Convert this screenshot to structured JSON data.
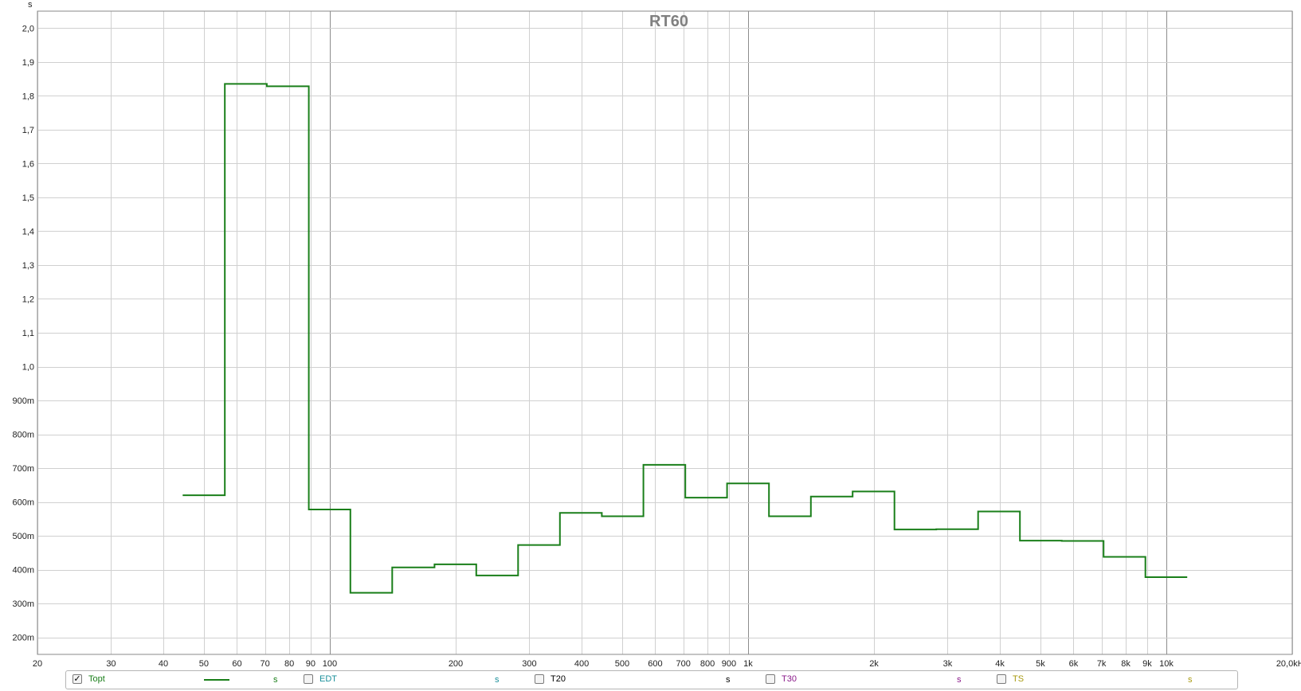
{
  "chart_data": {
    "type": "line",
    "title": "RT60",
    "ylabel": "s",
    "xlim": [
      20,
      20000
    ],
    "ylim": [
      0.15,
      2.05
    ],
    "x_scale": "log",
    "grid": true,
    "x_ticks": [
      {
        "v": 20,
        "label": "20"
      },
      {
        "v": 30,
        "label": "30"
      },
      {
        "v": 40,
        "label": "40"
      },
      {
        "v": 50,
        "label": "50"
      },
      {
        "v": 60,
        "label": "60"
      },
      {
        "v": 70,
        "label": "70"
      },
      {
        "v": 80,
        "label": "80"
      },
      {
        "v": 90,
        "label": "90"
      },
      {
        "v": 100,
        "label": "100"
      },
      {
        "v": 200,
        "label": "200"
      },
      {
        "v": 300,
        "label": "300"
      },
      {
        "v": 400,
        "label": "400"
      },
      {
        "v": 500,
        "label": "500"
      },
      {
        "v": 600,
        "label": "600"
      },
      {
        "v": 700,
        "label": "700"
      },
      {
        "v": 800,
        "label": "800"
      },
      {
        "v": 900,
        "label": "900"
      },
      {
        "v": 1000,
        "label": "1k"
      },
      {
        "v": 2000,
        "label": "2k"
      },
      {
        "v": 3000,
        "label": "3k"
      },
      {
        "v": 4000,
        "label": "4k"
      },
      {
        "v": 5000,
        "label": "5k"
      },
      {
        "v": 6000,
        "label": "6k"
      },
      {
        "v": 7000,
        "label": "7k"
      },
      {
        "v": 8000,
        "label": "8k"
      },
      {
        "v": 9000,
        "label": "9k"
      },
      {
        "v": 10000,
        "label": "10k"
      },
      {
        "v": 20000,
        "label": "20,0kHz"
      }
    ],
    "y_ticks": [
      {
        "v": 2.0,
        "label": "2,0"
      },
      {
        "v": 1.9,
        "label": "1,9"
      },
      {
        "v": 1.8,
        "label": "1,8"
      },
      {
        "v": 1.7,
        "label": "1,7"
      },
      {
        "v": 1.6,
        "label": "1,6"
      },
      {
        "v": 1.5,
        "label": "1,5"
      },
      {
        "v": 1.4,
        "label": "1,4"
      },
      {
        "v": 1.3,
        "label": "1,3"
      },
      {
        "v": 1.2,
        "label": "1,2"
      },
      {
        "v": 1.1,
        "label": "1,1"
      },
      {
        "v": 1.0,
        "label": "1,0"
      },
      {
        "v": 0.9,
        "label": "900m"
      },
      {
        "v": 0.8,
        "label": "800m"
      },
      {
        "v": 0.7,
        "label": "700m"
      },
      {
        "v": 0.6,
        "label": "600m"
      },
      {
        "v": 0.5,
        "label": "500m"
      },
      {
        "v": 0.4,
        "label": "400m"
      },
      {
        "v": 0.3,
        "label": "300m"
      },
      {
        "v": 0.2,
        "label": "200m"
      }
    ],
    "series": [
      {
        "name": "Topt",
        "color": "#1a7f1a",
        "step": true,
        "bands": [
          {
            "f_lo": 44.5,
            "f_hi": 56.1,
            "value": 0.62
          },
          {
            "f_lo": 56.1,
            "f_hi": 70.7,
            "value": 1.835
          },
          {
            "f_lo": 70.7,
            "f_hi": 89.1,
            "value": 1.828
          },
          {
            "f_lo": 89.1,
            "f_hi": 112,
            "value": 0.578
          },
          {
            "f_lo": 112,
            "f_hi": 141,
            "value": 0.332
          },
          {
            "f_lo": 141,
            "f_hi": 178,
            "value": 0.407
          },
          {
            "f_lo": 178,
            "f_hi": 224,
            "value": 0.416
          },
          {
            "f_lo": 224,
            "f_hi": 282,
            "value": 0.383
          },
          {
            "f_lo": 282,
            "f_hi": 355,
            "value": 0.473
          },
          {
            "f_lo": 355,
            "f_hi": 447,
            "value": 0.568
          },
          {
            "f_lo": 447,
            "f_hi": 562,
            "value": 0.558
          },
          {
            "f_lo": 562,
            "f_hi": 708,
            "value": 0.71
          },
          {
            "f_lo": 708,
            "f_hi": 891,
            "value": 0.613
          },
          {
            "f_lo": 891,
            "f_hi": 1122,
            "value": 0.655
          },
          {
            "f_lo": 1122,
            "f_hi": 1413,
            "value": 0.558
          },
          {
            "f_lo": 1413,
            "f_hi": 1778,
            "value": 0.616
          },
          {
            "f_lo": 1778,
            "f_hi": 2239,
            "value": 0.631
          },
          {
            "f_lo": 2239,
            "f_hi": 2818,
            "value": 0.519
          },
          {
            "f_lo": 2818,
            "f_hi": 3548,
            "value": 0.52
          },
          {
            "f_lo": 3548,
            "f_hi": 4467,
            "value": 0.572
          },
          {
            "f_lo": 4467,
            "f_hi": 5623,
            "value": 0.486
          },
          {
            "f_lo": 5623,
            "f_hi": 7079,
            "value": 0.485
          },
          {
            "f_lo": 7079,
            "f_hi": 8913,
            "value": 0.438
          },
          {
            "f_lo": 8913,
            "f_hi": 11220,
            "value": 0.378
          }
        ]
      }
    ]
  },
  "legend": {
    "items": [
      {
        "label": "Topt",
        "checked": true,
        "color": "#1a7f1a",
        "unit": "s",
        "unit_color": "#1a7f1a",
        "check_mark": "✓"
      },
      {
        "label": "EDT",
        "checked": false,
        "color": "#1a8f9a",
        "unit": "s",
        "unit_color": "#1a8f9a",
        "check_mark": ""
      },
      {
        "label": "T20",
        "checked": false,
        "color": "#000000",
        "unit": "s",
        "unit_color": "#000000",
        "check_mark": ""
      },
      {
        "label": "T30",
        "checked": false,
        "color": "#8a1a8a",
        "unit": "s",
        "unit_color": "#8a1a8a",
        "check_mark": ""
      },
      {
        "label": "TS",
        "checked": false,
        "color": "#a89a10",
        "unit": "s",
        "unit_color": "#a89a10",
        "check_mark": ""
      }
    ]
  }
}
